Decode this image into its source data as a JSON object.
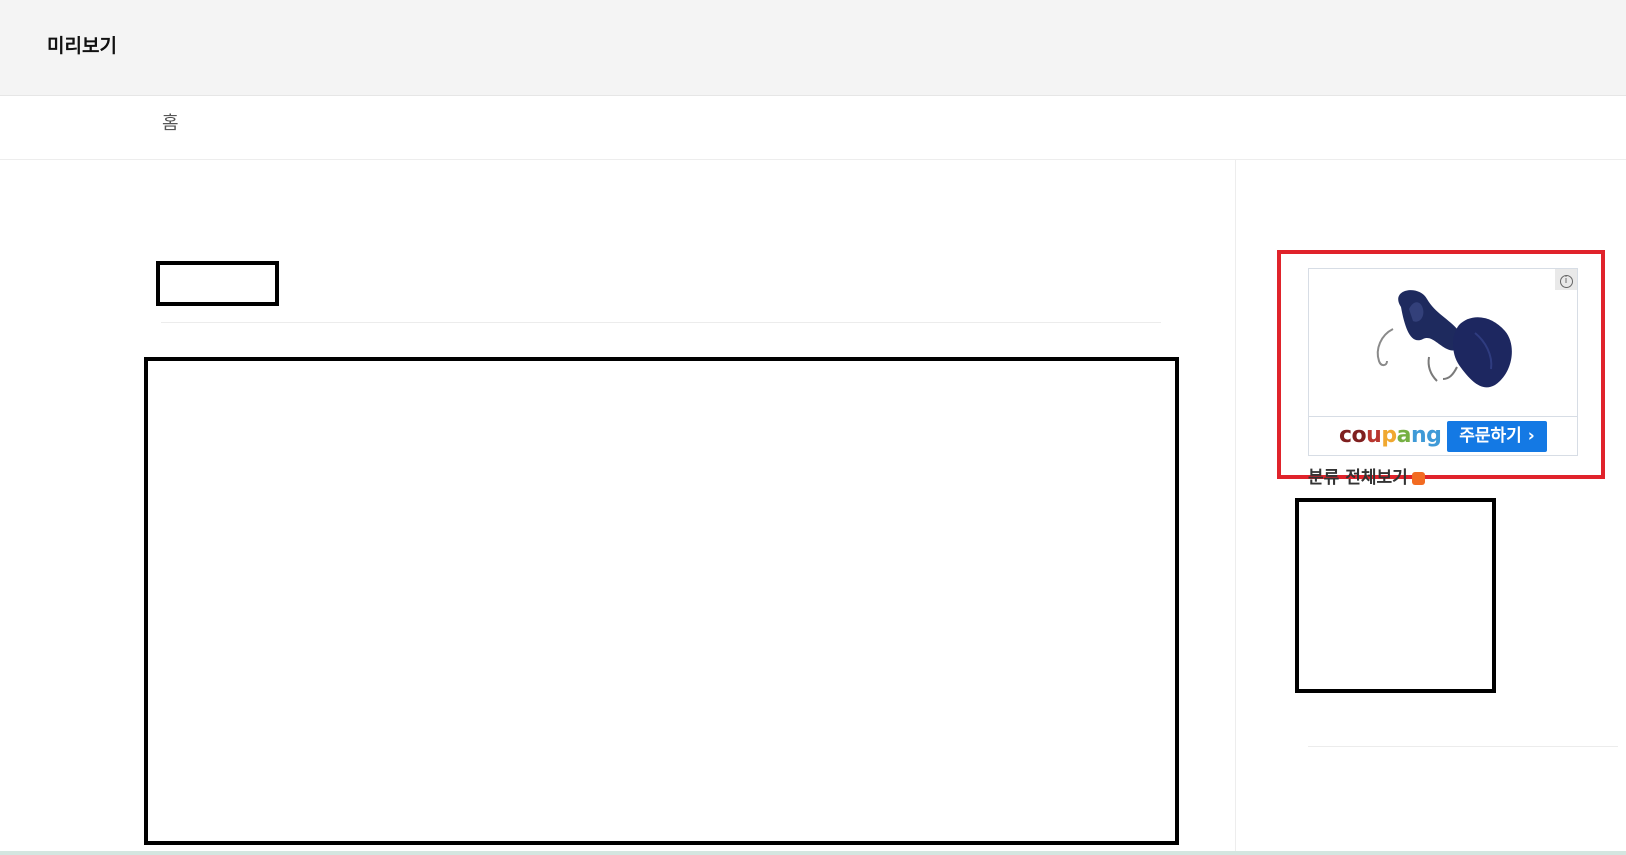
{
  "header": {
    "title": "미리보기"
  },
  "nav": {
    "home_label": "홈"
  },
  "ad": {
    "brand_parts": [
      "c",
      "o",
      "u",
      "p",
      "a",
      "n",
      "g"
    ],
    "order_label": "주문하기",
    "order_chevron": "›",
    "info_icon": "i",
    "highlight_color": "#e0232b",
    "button_color": "#1479e4"
  },
  "sidebar": {
    "category_label": "분류 전체보기",
    "category_dot_color": "#f26b22"
  }
}
